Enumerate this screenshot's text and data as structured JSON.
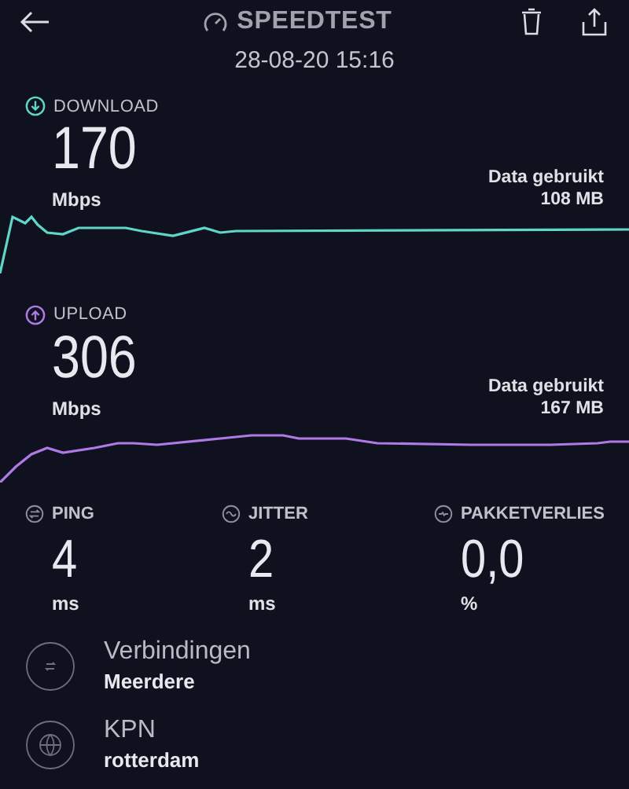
{
  "header": {
    "title": "SPEEDTEST",
    "date": "28-08-20 15:16"
  },
  "tests": [
    {
      "kind": "download",
      "label": "DOWNLOAD",
      "color": "#5fd6c8",
      "value": "170",
      "unit": "Mbps",
      "data_label": "Data gebruikt",
      "data_value": "108 MB"
    },
    {
      "kind": "upload",
      "label": "UPLOAD",
      "color": "#b07ae6",
      "value": "306",
      "unit": "Mbps",
      "data_label": "Data gebruikt",
      "data_value": "167 MB"
    }
  ],
  "metrics": [
    {
      "kind": "ping",
      "label": "PING",
      "value": "4",
      "unit": "ms"
    },
    {
      "kind": "jitter",
      "label": "JITTER",
      "value": "2",
      "unit": "ms"
    },
    {
      "kind": "loss",
      "label": "PAKKETVERLIES",
      "value": "0,0",
      "unit": "%"
    }
  ],
  "info": [
    {
      "kind": "connections",
      "title": "Verbindingen",
      "value": "Meerdere"
    },
    {
      "kind": "server",
      "title": "KPN",
      "value": "rotterdam"
    }
  ]
}
